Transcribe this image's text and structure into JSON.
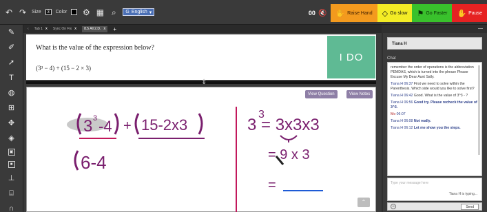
{
  "toolbar": {
    "size_label": "Size",
    "size_value": "3",
    "color_label": "Color",
    "language": "English",
    "counter": "00",
    "raise_hand": "Raise Hand",
    "go_slow": "Go slow",
    "go_faster": "Go Faster",
    "pause": "Pause"
  },
  "tabs": [
    {
      "label": "Tab 1"
    },
    {
      "label": "Sync On Fix"
    },
    {
      "label": "8.5 All 2.D."
    }
  ],
  "question": {
    "prompt": "What is the value of the expression below?",
    "expression": "(3³ − 4) + (15 − 2 × 3)",
    "banner": "I DO"
  },
  "whiteboard": {
    "view_question": "View Question",
    "view_notes": "View Notes"
  },
  "user": {
    "name": "Tiana H"
  },
  "chat": {
    "label": "Chat",
    "messages": [
      {
        "who": "",
        "text": "remember the order of operations is the abbreviation PEMDAS, which is turned into the phrase Please Excuse My Dear Aunt Sally."
      },
      {
        "who": "Tiana H",
        "time": "06:37",
        "text": "First we need to solve within the Parenthesis. Which side would you like to solve first?"
      },
      {
        "who": "Tiana H",
        "time": "06:42",
        "text": "Good. What is the value of 3^3 - ?"
      },
      {
        "who": "Tiana H",
        "time": "06:56",
        "text": "Good try. Please recheck the value of 3^3."
      },
      {
        "who": "Mo",
        "time": "06:07",
        "text": ""
      },
      {
        "who": "Tiana H",
        "time": "06:08",
        "text": "Not really."
      },
      {
        "who": "Tiana H",
        "time": "06:12",
        "text": "Let me show you the steps."
      }
    ],
    "input_placeholder": "Type your message here",
    "typing": "Tiana H is typing...",
    "send": "Send"
  }
}
